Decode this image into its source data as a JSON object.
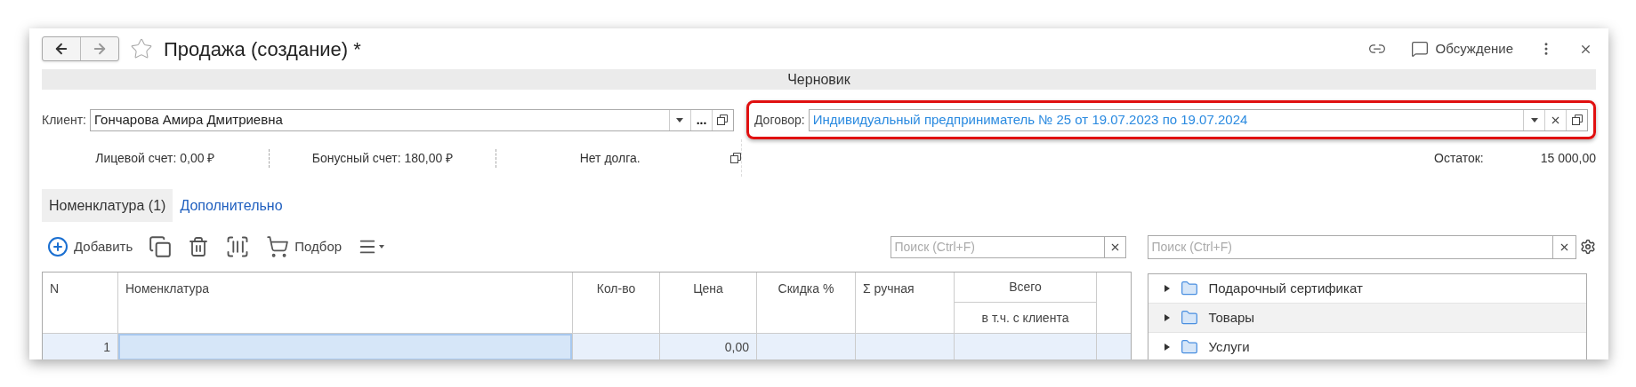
{
  "window": {
    "title": "Продажа (создание) *",
    "favorite": false,
    "actions": [
      {
        "kind": "link"
      },
      {
        "kind": "discussion",
        "label": "Обсуждение"
      },
      {
        "kind": "more"
      },
      {
        "kind": "close"
      }
    ]
  },
  "status": "Черновик",
  "client": {
    "label": "Клиент:",
    "value": "Гончарова Амира Дмитриевна",
    "select_button": "..."
  },
  "contract": {
    "label": "Договор:",
    "value": "Индивидуальный предприниматель № 25 от 19.07.2023 по 19.07.2024",
    "highlighted": true
  },
  "accounts": [
    "Лицевой счет: 0,00 ₽",
    "Бонусный счет: 180,00 ₽",
    "Нет долга."
  ],
  "balance": {
    "label": "Остаток:",
    "value": "15 000,00"
  },
  "tabs": [
    {
      "label": "Номенклатура (1)",
      "selected": true
    },
    {
      "label": "Дополнительно",
      "selected": false
    }
  ],
  "toolbar": [
    {
      "kind": "add",
      "label": "Добавить"
    },
    {
      "kind": "copy"
    },
    {
      "kind": "delete"
    },
    {
      "kind": "barcode"
    },
    {
      "kind": "pick",
      "label": "Подбор"
    },
    {
      "kind": "menu"
    }
  ],
  "table_search": {
    "placeholder": "Поиск (Ctrl+F)"
  },
  "table": {
    "columns": [
      "N",
      "Номенклатура",
      "Кол-во",
      "Цена",
      "Скидка %",
      "Σ ручная",
      "Всего"
    ],
    "subheader": "в т.ч. с клиента",
    "rows": [
      {
        "n": "1",
        "price": "0,00",
        "selected": true
      }
    ]
  },
  "tree_search": {
    "placeholder": "Поиск (Ctrl+F)"
  },
  "tree": [
    {
      "label": "Подарочный сертификат",
      "expanded": false,
      "selected": false
    },
    {
      "label": "Товары",
      "expanded": false,
      "selected": true
    },
    {
      "label": "Услуги",
      "expanded": false,
      "selected": false
    }
  ]
}
